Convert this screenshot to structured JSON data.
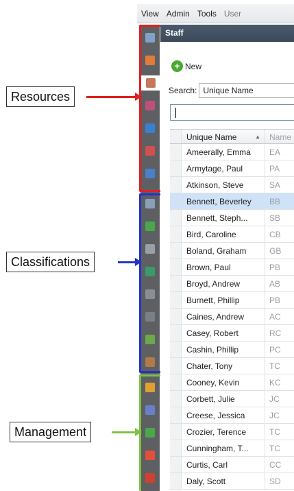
{
  "menu": {
    "items": [
      {
        "label": "View"
      },
      {
        "label": "Admin"
      },
      {
        "label": "Tools"
      },
      {
        "label": "User"
      }
    ]
  },
  "panel": {
    "title": "Staff",
    "new_label": "New",
    "search_label": "Search:",
    "search_field": "Unique Name",
    "search_value": ""
  },
  "grid": {
    "columns": [
      "Unique Name",
      "Name"
    ],
    "rows": [
      {
        "name": "Ameerally, Emma",
        "initials": "EA"
      },
      {
        "name": "Armytage, Paul",
        "initials": "PA"
      },
      {
        "name": "Atkinson, Steve",
        "initials": "SA"
      },
      {
        "name": "Bennett, Beverley",
        "initials": "BB",
        "selected": true
      },
      {
        "name": "Bennett, Steph...",
        "initials": "SB"
      },
      {
        "name": "Bird, Caroline",
        "initials": "CB"
      },
      {
        "name": "Boland, Graham",
        "initials": "GB"
      },
      {
        "name": "Brown, Paul",
        "initials": "PB"
      },
      {
        "name": "Broyd, Andrew",
        "initials": "AB"
      },
      {
        "name": "Burnett, Phillip",
        "initials": "PB"
      },
      {
        "name": "Caines, Andrew",
        "initials": "AC"
      },
      {
        "name": "Casey, Robert",
        "initials": "RC"
      },
      {
        "name": "Cashin, Phillip",
        "initials": "PC"
      },
      {
        "name": "Chater, Tony",
        "initials": "TC"
      },
      {
        "name": "Cooney, Kevin",
        "initials": "KC"
      },
      {
        "name": "Corbett, Julie",
        "initials": "JC"
      },
      {
        "name": "Creese, Jessica",
        "initials": "JC"
      },
      {
        "name": "Crozier, Terence",
        "initials": "TC"
      },
      {
        "name": "Cunningham, T...",
        "initials": "TC"
      },
      {
        "name": "Curtis, Carl",
        "initials": "CC"
      },
      {
        "name": "Daly, Scott",
        "initials": "SD"
      }
    ]
  },
  "callouts": {
    "resources": "Resources",
    "classifications": "Classifications",
    "management": "Management"
  },
  "colors": {
    "resources": "#e0201e",
    "classifications": "#2633c8",
    "management": "#7dc241"
  },
  "strip_icons": [
    {
      "name": "book-icon",
      "color": "#7fa3c8",
      "group": "resources"
    },
    {
      "name": "document-icon",
      "color": "#e07b3a",
      "group": "resources"
    },
    {
      "name": "person-icon",
      "color": "#c8785a",
      "group": "resources",
      "active": true
    },
    {
      "name": "group-icon",
      "color": "#c0507a",
      "group": "resources"
    },
    {
      "name": "user-icon",
      "color": "#3b7fd0",
      "group": "resources"
    },
    {
      "name": "users-icon",
      "color": "#d05050",
      "group": "resources"
    },
    {
      "name": "computer-icon",
      "color": "#4a80c8",
      "group": "resources"
    },
    {
      "name": "list-icon",
      "color": "#8a9fb8",
      "group": "classifications"
    },
    {
      "name": "grid-icon",
      "color": "#4aa84a",
      "group": "classifications"
    },
    {
      "name": "tag-icon",
      "color": "#9aa0a8",
      "group": "classifications"
    },
    {
      "name": "puzzle-icon",
      "color": "#3a9a6a",
      "group": "classifications"
    },
    {
      "name": "door-icon",
      "color": "#8a8f96",
      "group": "classifications"
    },
    {
      "name": "checklist-icon",
      "color": "#7a7f86",
      "group": "classifications"
    },
    {
      "name": "calendar-chart-icon",
      "color": "#6aaa4a",
      "group": "classifications"
    },
    {
      "name": "person-dark-icon",
      "color": "#b07a4a",
      "group": "classifications"
    },
    {
      "name": "clock-icon",
      "color": "#e0a030",
      "group": "management"
    },
    {
      "name": "book-stack-icon",
      "color": "#6a7fc8",
      "group": "management"
    },
    {
      "name": "table-icon",
      "color": "#4aa84a",
      "group": "management"
    },
    {
      "name": "badge-icon",
      "color": "#e0503a",
      "group": "management"
    },
    {
      "name": "admin-person-icon",
      "color": "#d04030",
      "group": "management"
    }
  ]
}
